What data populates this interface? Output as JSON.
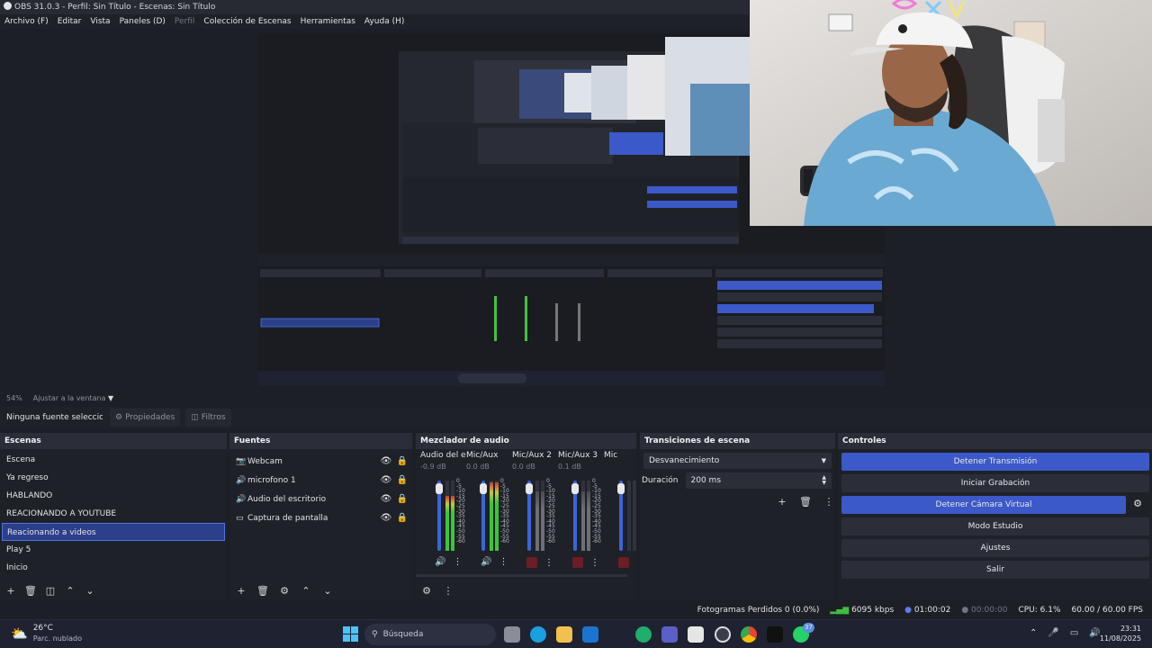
{
  "window": {
    "title": "OBS 31.0.3 - Perfil: Sin Título - Escenas: Sin Título"
  },
  "menu": [
    "Archivo (F)",
    "Editar",
    "Vista",
    "Paneles (D)",
    "Perfil",
    "Colección de Escenas",
    "Herramientas",
    "Ayuda (H)"
  ],
  "preview": {
    "zoom": "54%",
    "fit": "Ajustar a la ventana"
  },
  "context": {
    "no_source": "Ninguna fuente seleccionada",
    "properties": "Propiedades",
    "filters": "Filtros"
  },
  "scenes": {
    "title": "Escenas",
    "items": [
      "Escena",
      "Ya regreso",
      "HABLANDO",
      "REACIONANDO A YOUTUBE",
      "Reacionando a videos",
      "Play 5",
      "Inicio"
    ],
    "selected_index": 4
  },
  "sources": {
    "title": "Fuentes",
    "items": [
      {
        "name": "Webcam",
        "icon": "camera-icon"
      },
      {
        "name": "microfono 1",
        "icon": "speaker-icon"
      },
      {
        "name": "Audio del escritorio",
        "icon": "speaker-icon"
      },
      {
        "name": "Captura de pantalla",
        "icon": "monitor-icon"
      }
    ]
  },
  "mixer": {
    "title": "Mezclador de audio",
    "channels": [
      {
        "name": "Audio del escrito",
        "db": "-0.9 dB",
        "level": 0.78,
        "fader": 0.9,
        "muted": false
      },
      {
        "name": "Mic/Aux",
        "db": "0.0 dB",
        "level": 0.98,
        "fader": 0.9,
        "muted": false
      },
      {
        "name": "Mic/Aux 2",
        "db": "0.0 dB",
        "level": 0.85,
        "fader": 0.9,
        "muted": true
      },
      {
        "name": "Mic/Aux 3",
        "db": "0.1 dB",
        "level": 0.85,
        "fader": 0.9,
        "muted": true
      },
      {
        "name": "Mic",
        "db": "",
        "level": 0.0,
        "fader": 0.9,
        "muted": true
      }
    ],
    "scale": [
      "0",
      "-5",
      "-10",
      "-15",
      "-20",
      "-25",
      "-30",
      "-35",
      "-40",
      "-45",
      "-50",
      "-55",
      "-60"
    ]
  },
  "transitions": {
    "title": "Transiciones de escena",
    "type": "Desvanecimiento",
    "duration_label": "Duración",
    "duration": "200 ms"
  },
  "controls": {
    "title": "Controles",
    "buttons": [
      {
        "label": "Detener Transmisión",
        "active": true
      },
      {
        "label": "Iniciar Grabación",
        "active": false
      },
      {
        "label": "Detener Cámara Virtual",
        "active": true
      },
      {
        "label": "Modo Estudio",
        "active": false
      },
      {
        "label": "Ajustes",
        "active": false
      },
      {
        "label": "Salir",
        "active": false
      }
    ]
  },
  "status": {
    "dropped": "Fotogramas Perdidos 0 (0.0%)",
    "bitrate": "6095 kbps",
    "stream_time": "01:00:02",
    "rec_time": "00:00:00",
    "cpu": "CPU: 6.1%",
    "fps": "60.00 / 60.00 FPS"
  },
  "taskbar": {
    "weather_temp": "26°C",
    "weather_desc": "Parc. nublado",
    "search": "Búsqueda",
    "time": "23:31",
    "date": "11/08/2025",
    "badge": "37"
  },
  "colors": {
    "accent": "#3b59c8",
    "selection": "#2c3f8a",
    "panel_header": "#2b2e38",
    "background": "#1d1f26"
  }
}
